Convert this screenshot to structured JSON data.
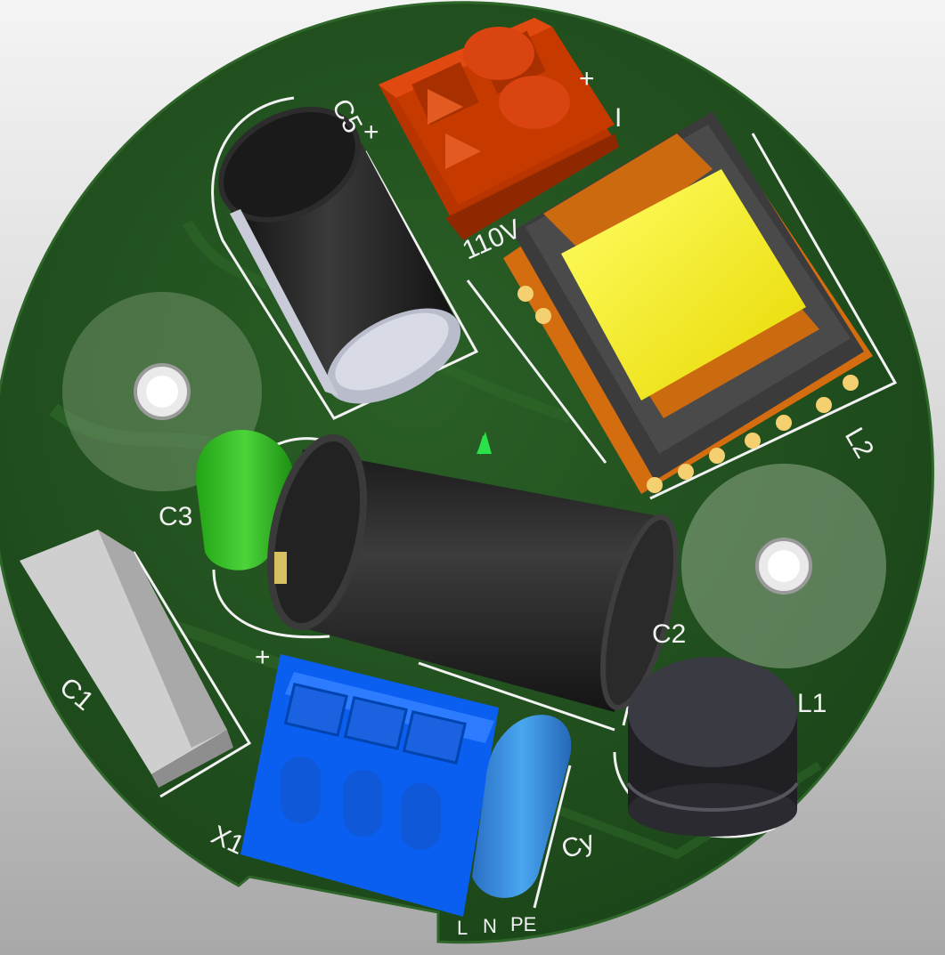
{
  "board": {
    "refdes": {
      "c5": "C5",
      "c3": "C3",
      "c1": "C1",
      "c2": "C2",
      "l1": "L1",
      "l2": "L2",
      "cy": "Cy",
      "x1": "X1"
    },
    "markings": {
      "plus_c5": "+",
      "plus_c2": "+",
      "plus_out": "+",
      "minus_out": "I",
      "voltage": "110V",
      "terminal_l": "L",
      "terminal_n": "N",
      "terminal_pe": "PE"
    }
  },
  "colors": {
    "pcb": "#1f4f1d",
    "silkscreen": "#f2f2f2",
    "out_connector": "#c63a00",
    "in_connector": "#0a5ff0",
    "transformer_bobbin": "#f7f01a",
    "transformer_frame": "#cc6a10",
    "electrolytic": "#1d1d1d",
    "x_cap": "#2fb520",
    "y_cap": "#3a8fe0",
    "film_cap": "#bdbdbd",
    "inductor": "#2e2e33",
    "pad_ring": "#7a9b72"
  }
}
